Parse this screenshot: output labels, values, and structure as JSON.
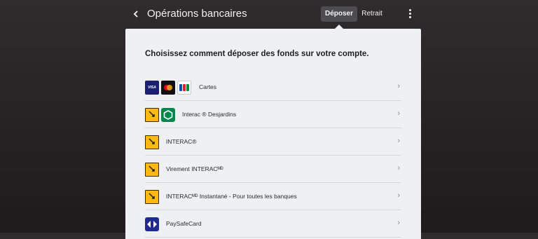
{
  "header": {
    "title": "Opérations bancaires",
    "tabs": {
      "deposit": "Déposer",
      "withdraw": "Retrait"
    }
  },
  "panel": {
    "heading": "Choisissez comment déposer des fonds sur votre compte.",
    "methods": [
      {
        "label": "Cartes",
        "icons": [
          "visa-icon",
          "mastercard-icon",
          "jcb-icon"
        ]
      },
      {
        "label": "Interac ® Desjardins",
        "icons": [
          "interac-icon",
          "desjardins-icon"
        ]
      },
      {
        "label": "INTERAC®",
        "icons": [
          "interac-icon"
        ]
      },
      {
        "label": "Virement INTERACᴹᴰ",
        "icons": [
          "interac-icon"
        ]
      },
      {
        "label": "INTERACᴹᴰ Instantané - Pour toutes les banques",
        "icons": [
          "interac-icon"
        ]
      },
      {
        "label": "PaySafeCard",
        "icons": [
          "paysafecard-icon"
        ]
      }
    ],
    "chevron": "›"
  },
  "icon_text": {
    "visa": "VISA"
  },
  "colors": {
    "background": "#2e2c2c",
    "panel": "#eef0f1",
    "active_tab": "#4d4c4f",
    "interac": "#fcb913",
    "desjardins": "#00874e",
    "visa": "#1a1f71",
    "paysafecard": "#1e2a8f"
  }
}
